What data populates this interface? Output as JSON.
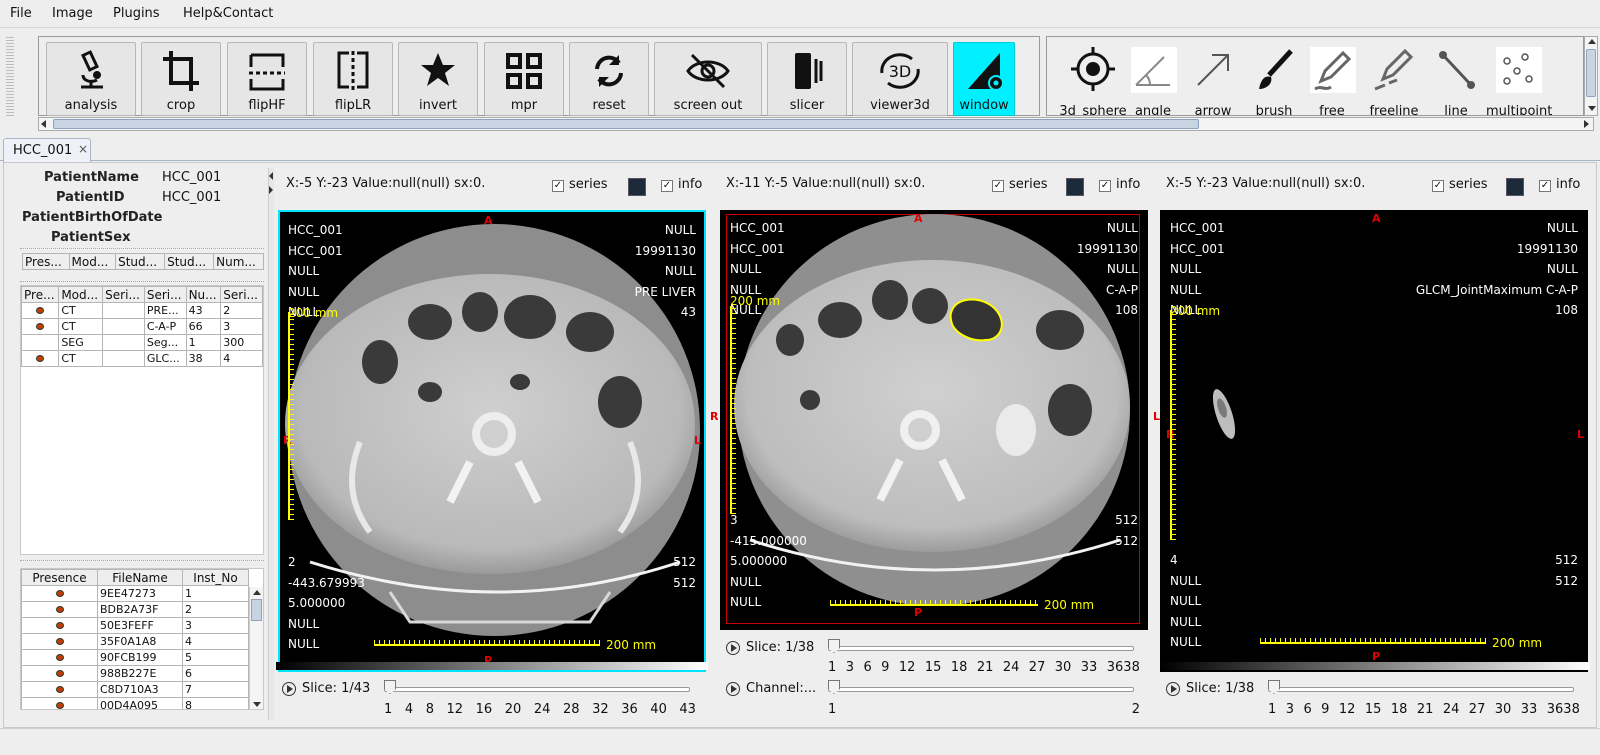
{
  "menu": [
    "File",
    "Image",
    "Plugins",
    "Help&Contact"
  ],
  "toolbar": [
    {
      "label": "analysis",
      "icon": "microscope-icon"
    },
    {
      "label": "crop",
      "icon": "crop-icon"
    },
    {
      "label": "flipHF",
      "icon": "flip-horizontal-icon"
    },
    {
      "label": "flipLR",
      "icon": "flip-lr-icon"
    },
    {
      "label": "invert",
      "icon": "star-icon"
    },
    {
      "label": "mpr",
      "icon": "grid-icon"
    },
    {
      "label": "reset",
      "icon": "reset-icon"
    },
    {
      "label": "screen out",
      "icon": "eye-off-icon"
    },
    {
      "label": "slicer",
      "icon": "slicer-icon"
    },
    {
      "label": "viewer3d",
      "icon": "viewer3d-icon",
      "text": "3D"
    },
    {
      "label": "window",
      "icon": "window-level-icon",
      "active": true
    }
  ],
  "tools": [
    {
      "label": "3d_sphere",
      "icon": "target-icon"
    },
    {
      "label": "angle",
      "icon": "angle-icon"
    },
    {
      "label": "arrow",
      "icon": "arrow-icon"
    },
    {
      "label": "brush",
      "icon": "brush-icon"
    },
    {
      "label": "free",
      "icon": "pencil-icon"
    },
    {
      "label": "freeline",
      "icon": "freeline-icon"
    },
    {
      "label": "line",
      "icon": "line-icon"
    },
    {
      "label": "multipoint",
      "icon": "multipoint-icon"
    }
  ],
  "tab": {
    "label": "HCC_001",
    "close": "×"
  },
  "patient": {
    "fields": [
      {
        "k": "PatientName",
        "v": "HCC_001"
      },
      {
        "k": "PatientID",
        "v": "HCC_001"
      },
      {
        "k": "PatientBirthOfDate",
        "v": ""
      },
      {
        "k": "PatientSex",
        "v": ""
      }
    ]
  },
  "study_table": {
    "headers": [
      "Pres...",
      "Mod...",
      "Stud...",
      "Stud...",
      "Num..."
    ]
  },
  "series_table": {
    "headers": [
      "Pre...",
      "Mod...",
      "Seri...",
      "Seri...",
      "Nu...",
      "Seri..."
    ],
    "rows": [
      {
        "icon": true,
        "cells": [
          "CT",
          "",
          "PRE...",
          "43",
          "2"
        ]
      },
      {
        "icon": true,
        "cells": [
          "CT",
          "",
          "C-A-P",
          "66",
          "3"
        ]
      },
      {
        "icon": false,
        "cells": [
          "SEG",
          "",
          "Seg...",
          "1",
          "300"
        ]
      },
      {
        "icon": true,
        "cells": [
          "CT",
          "",
          "GLC...",
          "38",
          "4"
        ]
      }
    ]
  },
  "file_table": {
    "headers": [
      "Presence",
      "FileName",
      "Inst_No"
    ],
    "rows": [
      [
        "9EE47273",
        "1"
      ],
      [
        "BDB2A73F",
        "2"
      ],
      [
        "50E3FEFF",
        "3"
      ],
      [
        "35F0A1A8",
        "4"
      ],
      [
        "90FCB199",
        "5"
      ],
      [
        "988B227E",
        "6"
      ],
      [
        "C8D710A3",
        "7"
      ],
      [
        "00D4A095",
        "8"
      ]
    ]
  },
  "viewers": [
    {
      "coord": "X:-5 Y:-23 Value:null(null) sx:0.",
      "series_label": "series",
      "info_label": "info",
      "tl": [
        "HCC_001",
        "HCC_001",
        "NULL",
        "NULL",
        "NULL"
      ],
      "tr": [
        "NULL",
        "19991130",
        "NULL",
        "PRE LIVER",
        "43"
      ],
      "bl": [
        "2",
        "-443.679993",
        "5.000000",
        "NULL",
        "NULL"
      ],
      "br": [
        "512",
        "512"
      ],
      "scale_label": "200 mm",
      "orient": {
        "top": "A",
        "left": "R",
        "right": "L",
        "bottom": "P"
      },
      "slice_text": "Slice: 1/43",
      "ticks": [
        "1",
        "4",
        "8",
        "12",
        "16",
        "20",
        "24",
        "28",
        "32",
        "36",
        "40",
        "43"
      ],
      "position": 0
    },
    {
      "coord": "X:-11 Y:-5 Value:null(null) sx:0.",
      "series_label": "series",
      "info_label": "info",
      "tl": [
        "HCC_001",
        "HCC_001",
        "NULL",
        "NULL",
        "NULL"
      ],
      "tr": [
        "NULL",
        "19991130",
        "NULL",
        "C-A-P",
        "108"
      ],
      "bl": [
        "3",
        "-415.000000",
        "5.000000",
        "NULL",
        "NULL"
      ],
      "br": [
        "512",
        "512"
      ],
      "scale_label": "200 mm",
      "scale_label_v": "200 mm",
      "orient": {
        "top": "A",
        "left": "R",
        "right": "L",
        "bottom": "P"
      },
      "slice_text": "Slice: 1/38",
      "ticks": [
        "1",
        "3",
        "6",
        "9",
        "12",
        "15",
        "18",
        "21",
        "24",
        "27",
        "30",
        "33",
        "3638"
      ],
      "channel_text": "Channel:...",
      "channel_ticks": [
        "1",
        "2"
      ],
      "position": 0
    },
    {
      "coord": "X:-5 Y:-23 Value:null(null) sx:0.",
      "series_label": "series",
      "info_label": "info",
      "tl": [
        "HCC_001",
        "HCC_001",
        "NULL",
        "NULL",
        "NULL"
      ],
      "tr": [
        "NULL",
        "19991130",
        "NULL",
        "GLCM_JointMaximum C-A-P",
        "108"
      ],
      "bl": [
        "4",
        "NULL",
        "NULL",
        "NULL",
        "NULL"
      ],
      "br": [
        "512",
        "512"
      ],
      "scale_label": "200 mm",
      "orient": {
        "top": "A",
        "left": "R",
        "right": "L",
        "bottom": "P"
      },
      "slice_text": "Slice: 1/38",
      "ticks": [
        "1",
        "3",
        "6",
        "9",
        "12",
        "15",
        "18",
        "21",
        "24",
        "27",
        "30",
        "33",
        "3638"
      ],
      "position": 0
    }
  ],
  "colors": {
    "active": "#00f0ff",
    "seg_outline": "#ffff00",
    "orient": "#e00000",
    "viewer_border_1": "#00e5ff",
    "viewer_border_2": "#cc0000"
  }
}
